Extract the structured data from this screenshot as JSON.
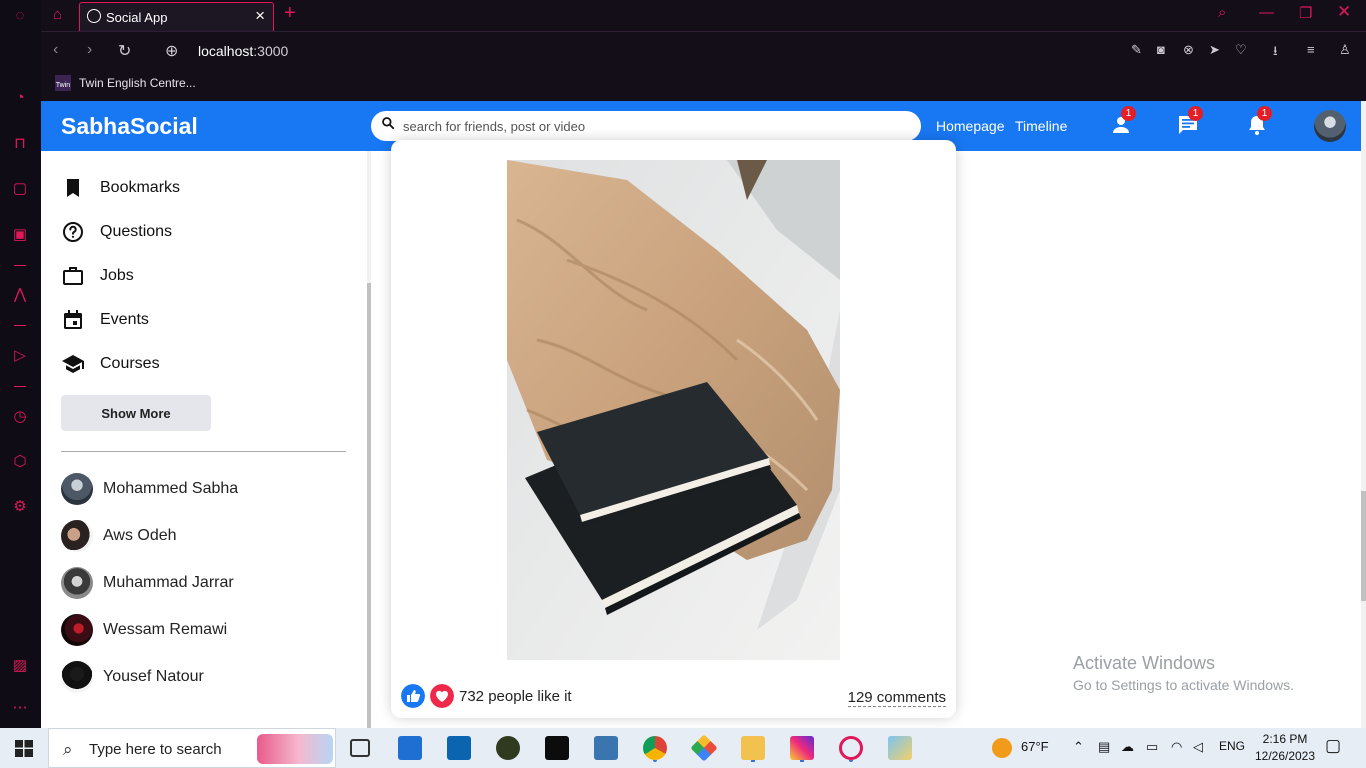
{
  "browser": {
    "tab_title": "Social App",
    "url_host": "localhost",
    "url_port": ":3000",
    "bookmark_icon_text": "Twin",
    "bookmark_label": "Twin English Centre...",
    "accent_color": "#e0185a"
  },
  "header": {
    "logo": "SabhaSocial",
    "search_placeholder": "search for friends, post or video",
    "links": [
      "Homepage",
      "Timeline"
    ],
    "badges": {
      "friends": "1",
      "messages": "1",
      "notifications": "1"
    },
    "brand_color": "#1877f2"
  },
  "sidebar": {
    "items": [
      {
        "label": "Bookmarks",
        "icon": "bookmark-icon"
      },
      {
        "label": "Questions",
        "icon": "help-icon"
      },
      {
        "label": "Jobs",
        "icon": "briefcase-icon"
      },
      {
        "label": "Events",
        "icon": "calendar-icon"
      },
      {
        "label": "Courses",
        "icon": "school-icon"
      }
    ],
    "show_more": "Show More",
    "friends": [
      "Mohammed Sabha",
      "Aws Odeh",
      "Muhammad Jarrar",
      "Wessam Remawi",
      "Yousef Natour"
    ]
  },
  "post": {
    "likes_text": "732 people like it",
    "comments_text": "129 comments"
  },
  "watermark": {
    "title": "Activate Windows",
    "subtitle": "Go to Settings to activate Windows."
  },
  "taskbar": {
    "search_text": "Type here to search",
    "weather": "67°F",
    "language": "ENG",
    "time": "2:16 PM",
    "date": "12/26/2023"
  }
}
